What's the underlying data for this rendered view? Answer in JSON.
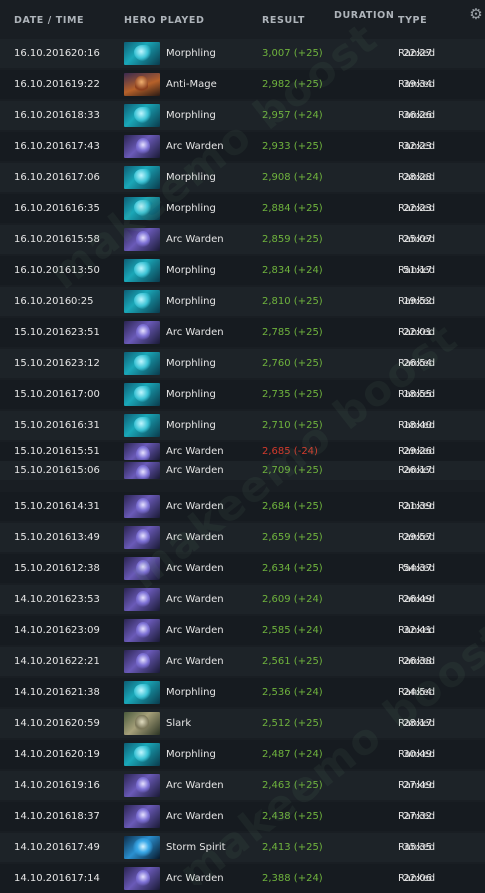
{
  "header": {
    "date_time": "DATE / TIME",
    "hero_played": "HERO PLAYED",
    "result": "RESULT",
    "duration": "DURATION",
    "type": "TYPE",
    "settings_icon": "gear-icon"
  },
  "watermark": {
    "text": "makeemo boost"
  },
  "rows": [
    {
      "date": "16.10.2016",
      "time": "20:16",
      "hero": "Morphling",
      "hero_icon": "morphling",
      "result": "3,007 (+25)",
      "outcome": "win",
      "duration": "22:27",
      "type": "Ranked"
    },
    {
      "date": "16.10.2016",
      "time": "19:22",
      "hero": "Anti-Mage",
      "hero_icon": "antimage",
      "result": "2,982 (+25)",
      "outcome": "win",
      "duration": "39:34",
      "type": "Ranked"
    },
    {
      "date": "16.10.2016",
      "time": "18:33",
      "hero": "Morphling",
      "hero_icon": "morphling",
      "result": "2,957 (+24)",
      "outcome": "win",
      "duration": "36:26",
      "type": "Ranked"
    },
    {
      "date": "16.10.2016",
      "time": "17:43",
      "hero": "Arc Warden",
      "hero_icon": "arcwarden",
      "result": "2,933 (+25)",
      "outcome": "win",
      "duration": "32:23",
      "type": "Ranked"
    },
    {
      "date": "16.10.2016",
      "time": "17:06",
      "hero": "Morphling",
      "hero_icon": "morphling",
      "result": "2,908 (+24)",
      "outcome": "win",
      "duration": "28:28",
      "type": "Ranked"
    },
    {
      "date": "16.10.2016",
      "time": "16:35",
      "hero": "Morphling",
      "hero_icon": "morphling",
      "result": "2,884 (+25)",
      "outcome": "win",
      "duration": "22:23",
      "type": "Ranked"
    },
    {
      "date": "16.10.2016",
      "time": "15:58",
      "hero": "Arc Warden",
      "hero_icon": "arcwarden",
      "result": "2,859 (+25)",
      "outcome": "win",
      "duration": "25:07",
      "type": "Ranked"
    },
    {
      "date": "16.10.2016",
      "time": "13:50",
      "hero": "Morphling",
      "hero_icon": "morphling",
      "result": "2,834 (+24)",
      "outcome": "win",
      "duration": "51:17",
      "type": "Ranked"
    },
    {
      "date": "16.10.2016",
      "time": "0:25",
      "hero": "Morphling",
      "hero_icon": "morphling",
      "result": "2,810 (+25)",
      "outcome": "win",
      "duration": "19:52",
      "type": "Ranked"
    },
    {
      "date": "15.10.2016",
      "time": "23:51",
      "hero": "Arc Warden",
      "hero_icon": "arcwarden",
      "result": "2,785 (+25)",
      "outcome": "win",
      "duration": "22:01",
      "type": "Ranked"
    },
    {
      "date": "15.10.2016",
      "time": "23:12",
      "hero": "Morphling",
      "hero_icon": "morphling",
      "result": "2,760 (+25)",
      "outcome": "win",
      "duration": "26:54",
      "type": "Ranked"
    },
    {
      "date": "15.10.2016",
      "time": "17:00",
      "hero": "Morphling",
      "hero_icon": "morphling",
      "result": "2,735 (+25)",
      "outcome": "win",
      "duration": "18:55",
      "type": "Ranked"
    },
    {
      "date": "15.10.2016",
      "time": "16:31",
      "hero": "Morphling",
      "hero_icon": "morphling",
      "result": "2,710 (+25)",
      "outcome": "win",
      "duration": "18:40",
      "type": "Ranked"
    },
    {
      "date": "15.10.2016",
      "time": "15:51",
      "hero": "Arc Warden",
      "hero_icon": "arcwarden",
      "result": "2,685 (-24)",
      "outcome": "loss",
      "duration": "29:26",
      "type": "Ranked"
    },
    {
      "date": "15.10.2016",
      "time": "15:06",
      "hero": "Arc Warden",
      "hero_icon": "arcwarden",
      "result": "2,709 (+25)",
      "outcome": "win",
      "duration": "26:17",
      "type": "Ranked"
    },
    {
      "date": "15.10.2016",
      "time": "14:31",
      "hero": "Arc Warden",
      "hero_icon": "arcwarden",
      "result": "2,684 (+25)",
      "outcome": "win",
      "duration": "21:39",
      "type": "Ranked"
    },
    {
      "date": "15.10.2016",
      "time": "13:49",
      "hero": "Arc Warden",
      "hero_icon": "arcwarden",
      "result": "2,659 (+25)",
      "outcome": "win",
      "duration": "29:57",
      "type": "Ranked"
    },
    {
      "date": "15.10.2016",
      "time": "12:38",
      "hero": "Arc Warden",
      "hero_icon": "arcwarden",
      "result": "2,634 (+25)",
      "outcome": "win",
      "duration": "54:37",
      "type": "Ranked"
    },
    {
      "date": "14.10.2016",
      "time": "23:53",
      "hero": "Arc Warden",
      "hero_icon": "arcwarden",
      "result": "2,609 (+24)",
      "outcome": "win",
      "duration": "26:49",
      "type": "Ranked"
    },
    {
      "date": "14.10.2016",
      "time": "23:09",
      "hero": "Arc Warden",
      "hero_icon": "arcwarden",
      "result": "2,585 (+24)",
      "outcome": "win",
      "duration": "32:41",
      "type": "Ranked"
    },
    {
      "date": "14.10.2016",
      "time": "22:21",
      "hero": "Arc Warden",
      "hero_icon": "arcwarden",
      "result": "2,561 (+25)",
      "outcome": "win",
      "duration": "26:38",
      "type": "Ranked"
    },
    {
      "date": "14.10.2016",
      "time": "21:38",
      "hero": "Morphling",
      "hero_icon": "morphling",
      "result": "2,536 (+24)",
      "outcome": "win",
      "duration": "24:54",
      "type": "Ranked"
    },
    {
      "date": "14.10.2016",
      "time": "20:59",
      "hero": "Slark",
      "hero_icon": "slark",
      "result": "2,512 (+25)",
      "outcome": "win",
      "duration": "28:17",
      "type": "Ranked"
    },
    {
      "date": "14.10.2016",
      "time": "20:19",
      "hero": "Morphling",
      "hero_icon": "morphling",
      "result": "2,487 (+24)",
      "outcome": "win",
      "duration": "30:49",
      "type": "Ranked"
    },
    {
      "date": "14.10.2016",
      "time": "19:16",
      "hero": "Arc Warden",
      "hero_icon": "arcwarden",
      "result": "2,463 (+25)",
      "outcome": "win",
      "duration": "27:49",
      "type": "Ranked"
    },
    {
      "date": "14.10.2016",
      "time": "18:37",
      "hero": "Arc Warden",
      "hero_icon": "arcwarden",
      "result": "2,438 (+25)",
      "outcome": "win",
      "duration": "27:32",
      "type": "Ranked"
    },
    {
      "date": "14.10.2016",
      "time": "17:49",
      "hero": "Storm Spirit",
      "hero_icon": "stormspirit",
      "result": "2,413 (+25)",
      "outcome": "win",
      "duration": "35:35",
      "type": "Ranked"
    },
    {
      "date": "14.10.2016",
      "time": "17:14",
      "hero": "Arc Warden",
      "hero_icon": "arcwarden",
      "result": "2,388 (+24)",
      "outcome": "win",
      "duration": "22:06",
      "type": "Ranked"
    }
  ],
  "colors": {
    "background": "#191e23",
    "win": "#6fb33d",
    "loss": "#d33a2c",
    "header_text": "#aeb4ba"
  }
}
